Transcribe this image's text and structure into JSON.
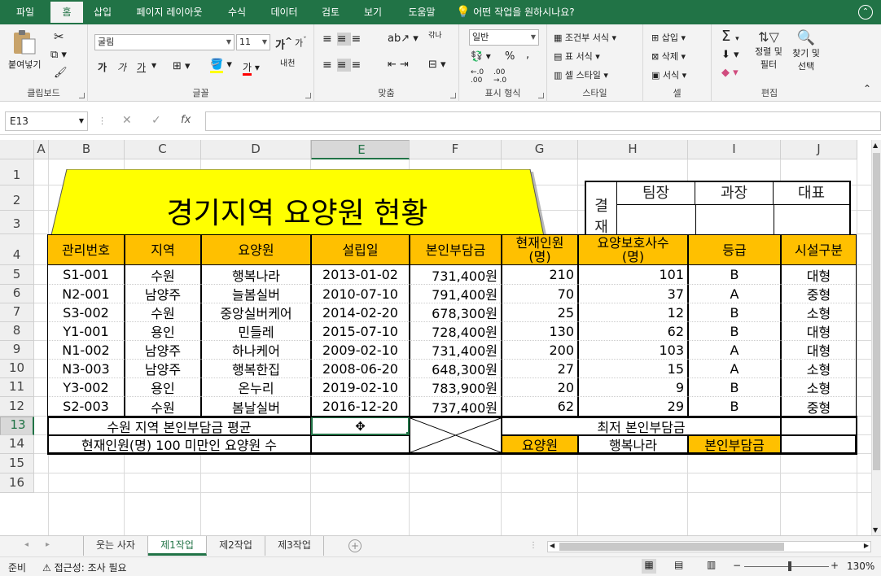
{
  "ribbon_tabs": [
    "파일",
    "홈",
    "삽입",
    "페이지 레이아웃",
    "수식",
    "데이터",
    "검토",
    "보기",
    "도움말"
  ],
  "tell_me": "어떤 작업을 원하시나요?",
  "clipboard": {
    "paste": "붙여넣기",
    "label": "클립보드"
  },
  "font": {
    "name": "굴림",
    "size": "11",
    "bold": "가",
    "italic": "가",
    "underline": "가",
    "grow": "가",
    "shrink": "가",
    "color_a": "가",
    "phonetic": "내천",
    "label": "글꼴"
  },
  "align": {
    "label": "맞춤",
    "wrap": "갂나"
  },
  "number": {
    "format": "일반",
    "label": "표시 형식"
  },
  "styles": {
    "cond": "조건부 서식",
    "table": "표 서식",
    "cell": "셀 스타일",
    "label": "스타일"
  },
  "cells": {
    "insert": "삽입",
    "delete": "삭제",
    "format": "서식",
    "label": "셀"
  },
  "editing": {
    "sort": "정렬 및",
    "sort2": "필터",
    "find": "찾기 및",
    "find2": "선택",
    "label": "편집"
  },
  "name_box": "E13",
  "fx": "fx",
  "columns": [
    "A",
    "B",
    "C",
    "D",
    "E",
    "F",
    "G",
    "H",
    "I",
    "J"
  ],
  "rows": [
    "1",
    "2",
    "3",
    "4",
    "5",
    "6",
    "7",
    "8",
    "9",
    "10",
    "11",
    "12",
    "13",
    "14",
    "15",
    "16"
  ],
  "title": "경기지역 요양원 현황",
  "approval": {
    "side1": "결",
    "side2": "재",
    "h1": "팀장",
    "h2": "과장",
    "h3": "대표"
  },
  "headers": [
    "관리번호",
    "지역",
    "요양원",
    "설립일",
    "본인부담금",
    "현재인원\n(명)",
    "요양보호사수\n(명)",
    "등급",
    "시설구분"
  ],
  "table": [
    [
      "S1-001",
      "수원",
      "행복나라",
      "2013-01-02",
      "731,400원",
      "210",
      "101",
      "B",
      "대형"
    ],
    [
      "N2-001",
      "남양주",
      "늘봄실버",
      "2010-07-10",
      "791,400원",
      "70",
      "37",
      "A",
      "중형"
    ],
    [
      "S3-002",
      "수원",
      "중앙실버케어",
      "2014-02-20",
      "678,300원",
      "25",
      "12",
      "B",
      "소형"
    ],
    [
      "Y1-001",
      "용인",
      "민들레",
      "2015-07-10",
      "728,400원",
      "130",
      "62",
      "B",
      "대형"
    ],
    [
      "N1-002",
      "남양주",
      "하나케어",
      "2009-02-10",
      "731,400원",
      "200",
      "103",
      "A",
      "대형"
    ],
    [
      "N3-003",
      "남양주",
      "행복한집",
      "2008-06-20",
      "648,300원",
      "27",
      "15",
      "A",
      "소형"
    ],
    [
      "Y3-002",
      "용인",
      "온누리",
      "2019-02-10",
      "783,900원",
      "20",
      "9",
      "B",
      "소형"
    ],
    [
      "S2-003",
      "수원",
      "봄날실버",
      "2016-12-20",
      "737,400원",
      "62",
      "29",
      "B",
      "중형"
    ]
  ],
  "summary": {
    "r13_label": "수원 지역 본인부담금 평균",
    "r14_label": "현재인원(명) 100 미만인 요양원 수",
    "min_title": "최저 본인부담금",
    "k1": "요양원",
    "v1": "행복나라",
    "k2": "본인부담금"
  },
  "sheet_tabs": [
    "웃는 사자",
    "제1작업",
    "제2작업",
    "제3작업"
  ],
  "status": {
    "ready": "준비",
    "access": "접근성: 조사 필요",
    "zoom": "130%"
  },
  "colors": {
    "excel_green": "#217346",
    "header_orange": "#ffc000",
    "title_yellow": "#ffff00"
  }
}
